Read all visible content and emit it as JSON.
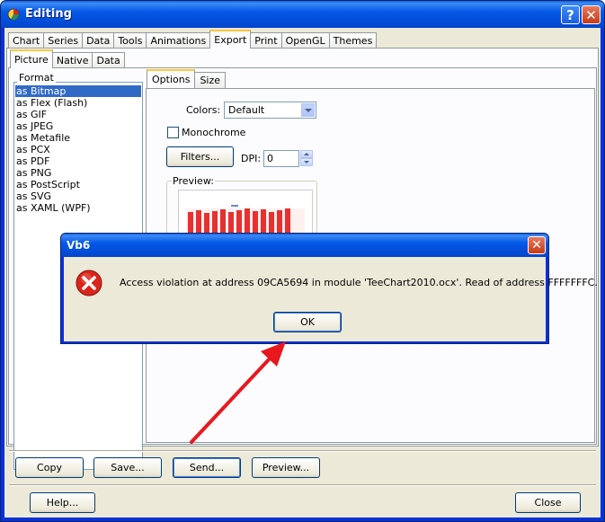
{
  "window": {
    "title": "Editing",
    "help_glyph": "?",
    "close_glyph": "✕"
  },
  "main_tabs": [
    "Chart",
    "Series",
    "Data",
    "Tools",
    "Animations",
    "Export",
    "Print",
    "OpenGL",
    "Themes"
  ],
  "sub_tabs": [
    "Picture",
    "Native",
    "Data"
  ],
  "format": {
    "label": "Format",
    "items": [
      "as Bitmap",
      "as Flex (Flash)",
      "as GIF",
      "as JPEG",
      "as Metafile",
      "as PCX",
      "as PDF",
      "as PNG",
      "as PostScript",
      "as SVG",
      "as XAML (WPF)"
    ],
    "selected_index": 0
  },
  "option_tabs": [
    "Options",
    "Size"
  ],
  "options": {
    "colors_label": "Colors:",
    "colors_value": "Default",
    "monochrome_label": "Monochrome",
    "filters_label": "Filters...",
    "dpi_label": "DPI:",
    "dpi_value": "0",
    "preview_label": "Preview:"
  },
  "buttons": {
    "copy": "Copy",
    "save": "Save...",
    "send": "Send...",
    "preview": "Preview...",
    "help": "Help...",
    "close": "Close"
  },
  "dialog": {
    "title": "Vb6",
    "close_glyph": "✕",
    "message": "Access violation at address 09CA5694 in module 'TeeChart2010.ocx'. Read of address FFFFFFFC.",
    "ok_label": "OK"
  },
  "colors": {
    "title_bar": "#0458e6",
    "face": "#ece9d8",
    "selection": "#316ac5",
    "error_red": "#d9261c",
    "arrow_red": "#e8181e"
  }
}
